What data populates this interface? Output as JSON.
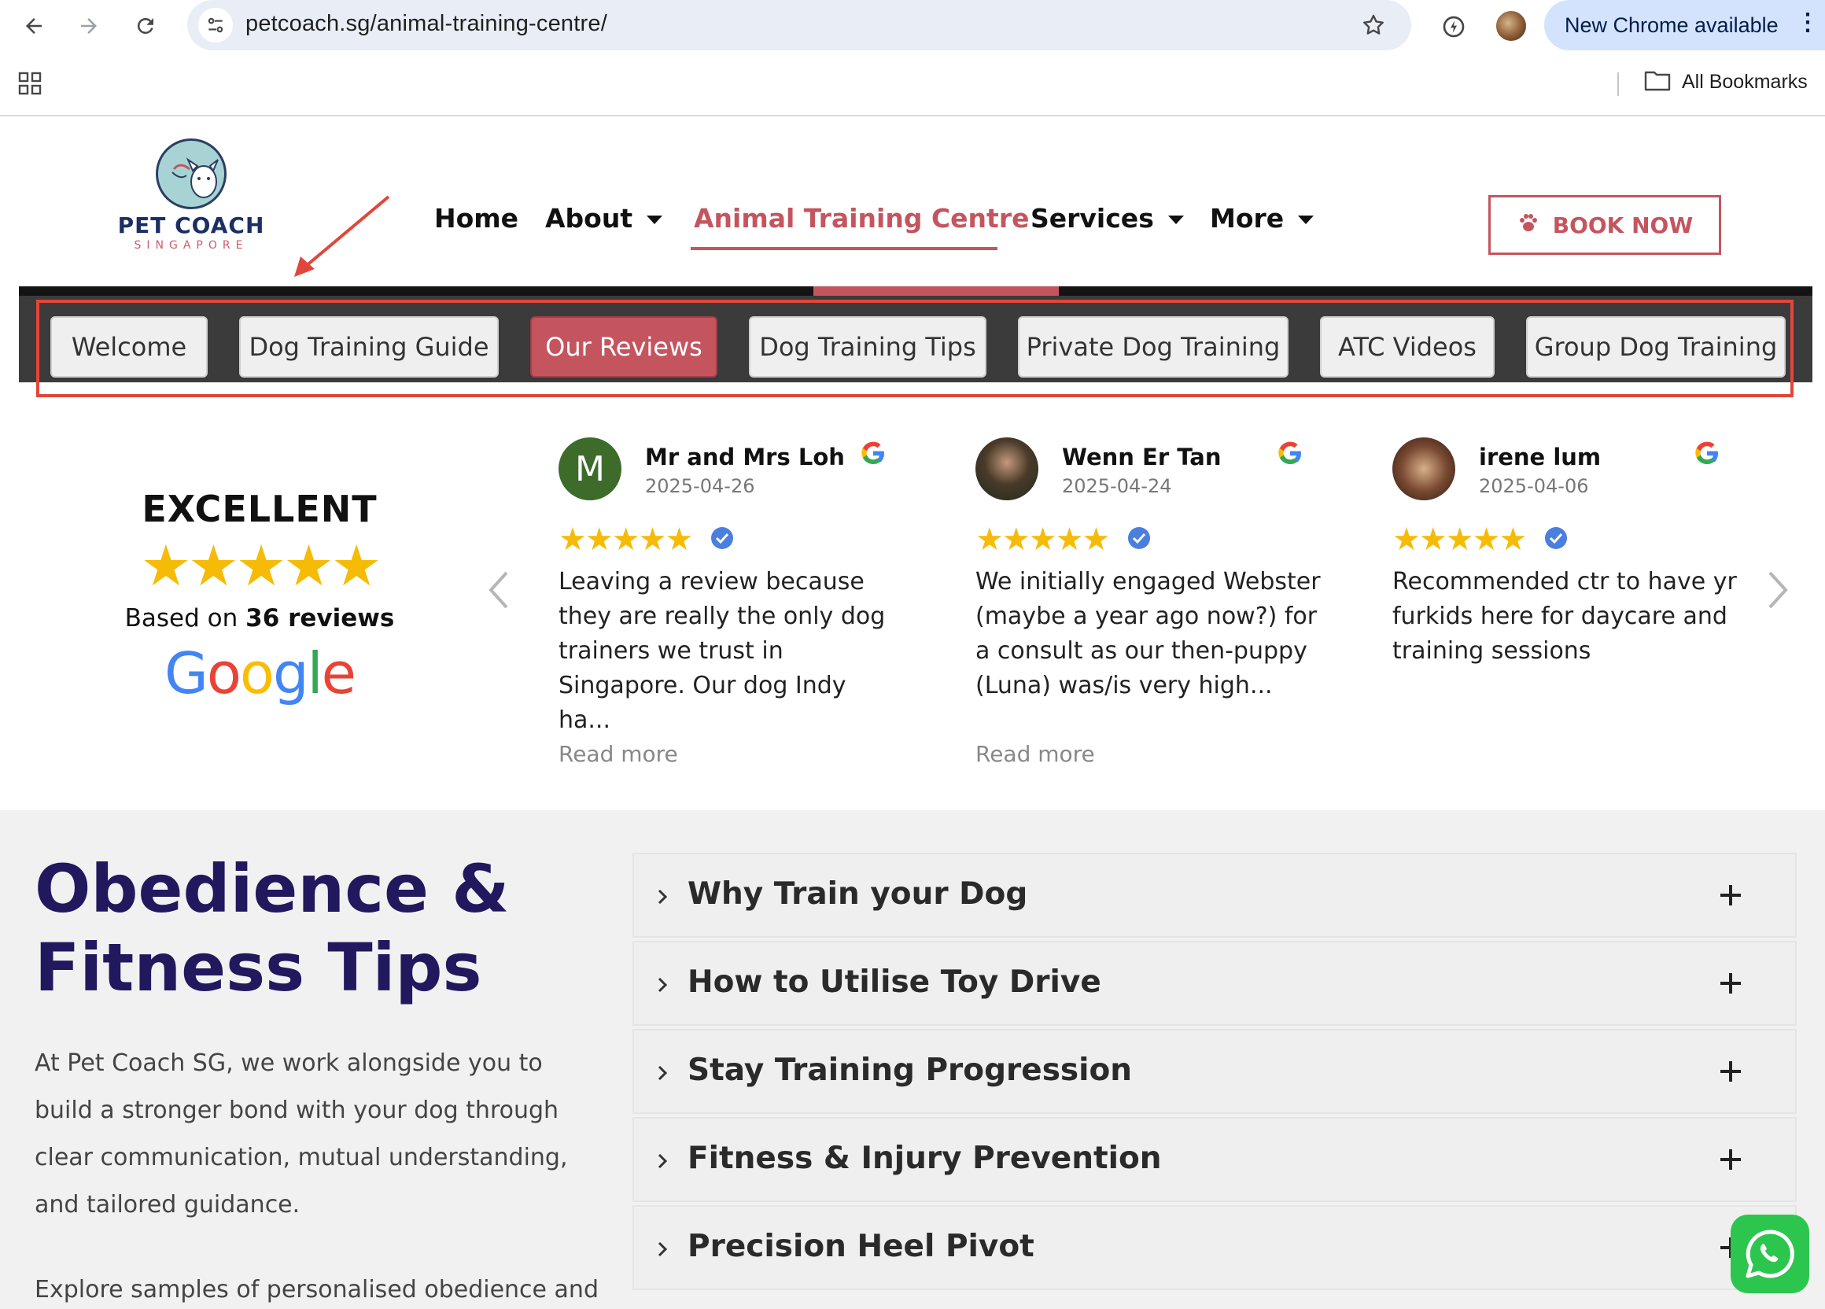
{
  "browser": {
    "url": "petcoach.sg/animal-training-centre/",
    "chrome_update_label": "New Chrome available",
    "bookmarks_label": "All Bookmarks"
  },
  "site": {
    "logo_text": "PET COACH",
    "logo_subtext": "SINGAPORE",
    "nav": [
      {
        "label": "Home",
        "has_caret": false,
        "active": false
      },
      {
        "label": "About",
        "has_caret": true,
        "active": false
      },
      {
        "label": "Animal Training Centre",
        "has_caret": false,
        "active": true
      },
      {
        "label": "Services",
        "has_caret": true,
        "active": false
      },
      {
        "label": "More",
        "has_caret": true,
        "active": false
      }
    ],
    "book_now_label": "BOOK NOW",
    "accent_color": "#c4555f"
  },
  "tabs": [
    {
      "label": "Welcome",
      "active": false
    },
    {
      "label": "Dog Training Guide",
      "active": false
    },
    {
      "label": "Our Reviews",
      "active": true
    },
    {
      "label": "Dog Training Tips",
      "active": false
    },
    {
      "label": "Private Dog Training",
      "active": false
    },
    {
      "label": "ATC Videos",
      "active": false
    },
    {
      "label": "Group Dog Training",
      "active": false
    }
  ],
  "summary": {
    "rating_word": "EXCELLENT",
    "stars": 5,
    "based_prefix": "Based on",
    "based_count": "36 reviews",
    "provider": "Google"
  },
  "reviews": [
    {
      "name": "Mr and Mrs Loh",
      "date": "2025-04-26",
      "avatar_letter": "M",
      "avatar_color": "#3d6b2a",
      "stars": 5,
      "text": "Leaving a review because they are really the only dog trainers we trust in Singapore. Our dog Indy ha...",
      "read_more": "Read more"
    },
    {
      "name": "Wenn Er Tan",
      "date": "2025-04-24",
      "avatar_letter": "",
      "avatar_color": "#2f3a2c",
      "stars": 5,
      "text": "We initially engaged Webster (maybe a year ago now?) for a consult as our then-puppy (Luna) was/is very high...",
      "read_more": "Read more"
    },
    {
      "name": "irene lum",
      "date": "2025-04-06",
      "avatar_letter": "",
      "avatar_color": "#5a3a2a",
      "stars": 5,
      "text": "Recommended ctr to have yr furkids here for daycare and training sessions",
      "read_more": ""
    }
  ],
  "lower": {
    "title_line1": "Obedience &",
    "title_line2": "Fitness Tips",
    "paragraph": "At Pet Coach SG, we work alongside you to build a stronger bond with your dog through clear communication, mutual understanding, and tailored guidance.",
    "paragraph2": "Explore samples of personalised obedience and",
    "accordion": [
      "Why Train your Dog",
      "How to Utilise Toy Drive",
      "Stay Training Progression",
      "Fitness & Injury Prevention",
      "Precision Heel Pivot"
    ]
  }
}
